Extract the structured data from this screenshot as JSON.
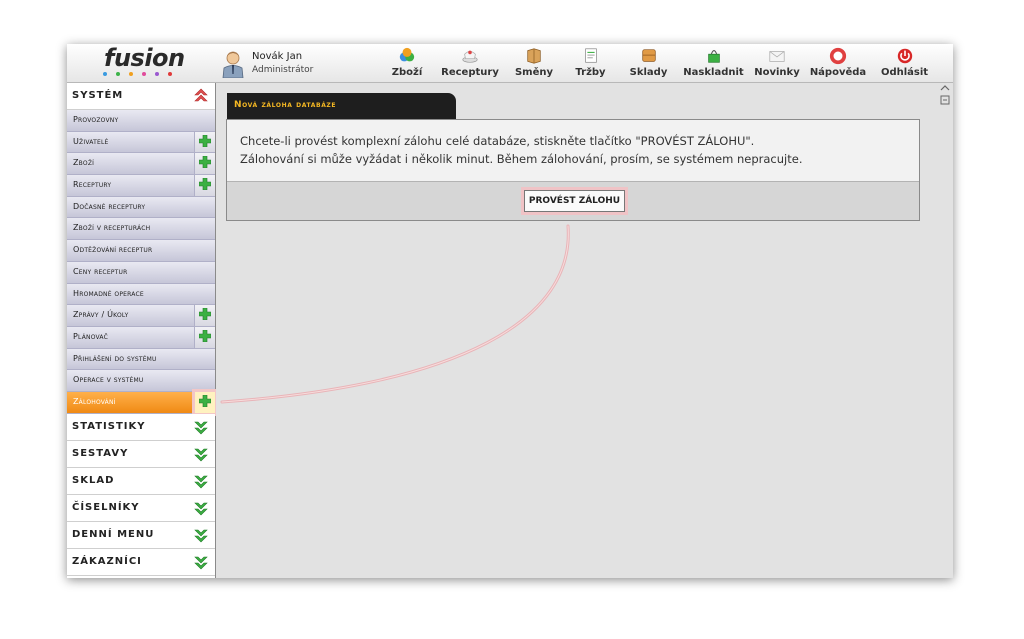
{
  "header": {
    "logo": "fusion",
    "logo_dot_colors": [
      "#3a9be0",
      "#3db34a",
      "#f0a020",
      "#e04c9c",
      "#9b59d0",
      "#e03b3b"
    ],
    "user_name": "Novák Jan",
    "user_role": "Administrátor",
    "toolbar": [
      {
        "label": "Zboží",
        "icon": "goods-icon"
      },
      {
        "label": "Receptury",
        "icon": "recipes-icon"
      },
      {
        "label": "Směny",
        "icon": "shifts-icon"
      },
      {
        "label": "Tržby",
        "icon": "sales-icon"
      },
      {
        "label": "Sklady",
        "icon": "warehouse-icon"
      },
      {
        "label": "Naskladnit",
        "icon": "stock-in-icon"
      },
      {
        "label": "Novinky",
        "icon": "news-icon"
      },
      {
        "label": "Nápověda",
        "icon": "help-icon"
      },
      {
        "label": "Odhlásit",
        "icon": "logout-icon"
      }
    ]
  },
  "sidebar": {
    "system_label": "SYSTÉM",
    "items": [
      {
        "label": "Provozovny",
        "plus": false
      },
      {
        "label": "Uživatelé",
        "plus": true
      },
      {
        "label": "Zboží",
        "plus": true
      },
      {
        "label": "Receptury",
        "plus": true
      },
      {
        "label": "Dočasné receptury",
        "plus": false
      },
      {
        "label": "Zboží v recepturách",
        "plus": false
      },
      {
        "label": "Odtěžování receptur",
        "plus": false
      },
      {
        "label": "Ceny receptur",
        "plus": false
      },
      {
        "label": "Hromadné operace",
        "plus": false
      },
      {
        "label": "Zprávy / Úkoly",
        "plus": true
      },
      {
        "label": "Plánovač",
        "plus": true
      },
      {
        "label": "Přihlášení do systému",
        "plus": false
      },
      {
        "label": "Operace v systému",
        "plus": false
      },
      {
        "label": "Zálohování",
        "plus": true,
        "active": true
      }
    ],
    "categories": [
      "STATISTIKY",
      "SESTAVY",
      "SKLAD",
      "ČÍSELNÍKY",
      "DENNÍ MENU",
      "ZÁKAZNÍCI"
    ]
  },
  "main": {
    "tab_title": "Nová záloha databáze",
    "text_line1": "Chcete-li provést komplexní zálohu celé databáze, stiskněte tlačítko \"PROVÉST ZÁLOHU\".",
    "text_line2": "Zálohování si může vyžádat i několik minut. Během zálohování, prosím, se systémem nepracujte.",
    "button_label": "PROVÉST ZÁLOHU"
  },
  "colors": {
    "active_item": "#f39c1f",
    "tab_background": "#1e1e1e",
    "tab_text": "#f5b823",
    "plus_green": "#3cb043",
    "callout": "#e8b4b8"
  }
}
